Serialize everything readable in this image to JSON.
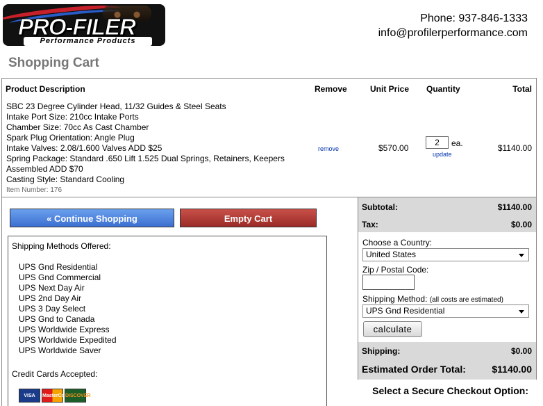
{
  "header": {
    "logo_text": "PRO-FILER",
    "logo_sub": "Performance Products",
    "phone": "Phone: 937-846-1333",
    "email": "info@profilerperformance.com"
  },
  "page_title": "Shopping Cart",
  "cart": {
    "columns": [
      "Product Description",
      "Remove",
      "Unit Price",
      "Quantity",
      "Total"
    ],
    "item": {
      "lines": [
        "SBC 23 Degree Cylinder Head, 11/32 Guides & Steel Seats",
        "Intake Port Size: 210cc Intake Ports",
        "Chamber Size: 70cc As Cast Chamber",
        "Spark Plug Orientation: Angle Plug",
        "Intake Valves: 2.08/1.600 Valves ADD $25",
        "Spring Package: Standard .650 Lift 1.525 Dual Springs, Retainers, Keepers",
        "Assembled ADD $70",
        "Casting Style: Standard Cooling"
      ],
      "item_number": "Item Number: 176",
      "remove_label": "remove",
      "unit_price": "$570.00",
      "quantity": "2",
      "qty_suffix": "ea.",
      "update_label": "update",
      "total": "$1140.00"
    }
  },
  "buttons": {
    "continue": "« Continue Shopping",
    "empty": "Empty Cart"
  },
  "shipping_info": {
    "title": "Shipping Methods Offered:",
    "methods": [
      "UPS Gnd Residential",
      "UPS Gnd Commercial",
      "UPS Next Day Air",
      "UPS 2nd Day Air",
      "UPS 3 Day Select",
      "UPS Gnd to Canada",
      "UPS Worldwide Express",
      "UPS Worldwide Expedited",
      "UPS Worldwide Saver"
    ],
    "cards_title": "Credit Cards Accepted:",
    "cards": [
      "VISA",
      "MasterCard",
      "DISCOVER"
    ]
  },
  "summary": {
    "subtotal_label": "Subtotal:",
    "subtotal": "$1140.00",
    "tax_label": "Tax:",
    "tax": "$0.00",
    "country_label": "Choose a Country:",
    "country_value": "United States",
    "zip_label": "Zip / Postal Code:",
    "zip_value": "",
    "method_label": "Shipping Method:",
    "method_note": "(all costs are estimated)",
    "method_value": "UPS Gnd Residential",
    "calculate": "calculate",
    "shipping_label": "Shipping:",
    "shipping": "$0.00",
    "est_label": "Estimated Order Total:",
    "est_total": "$1140.00"
  },
  "checkout_heading": "Select a Secure Checkout Option:"
}
